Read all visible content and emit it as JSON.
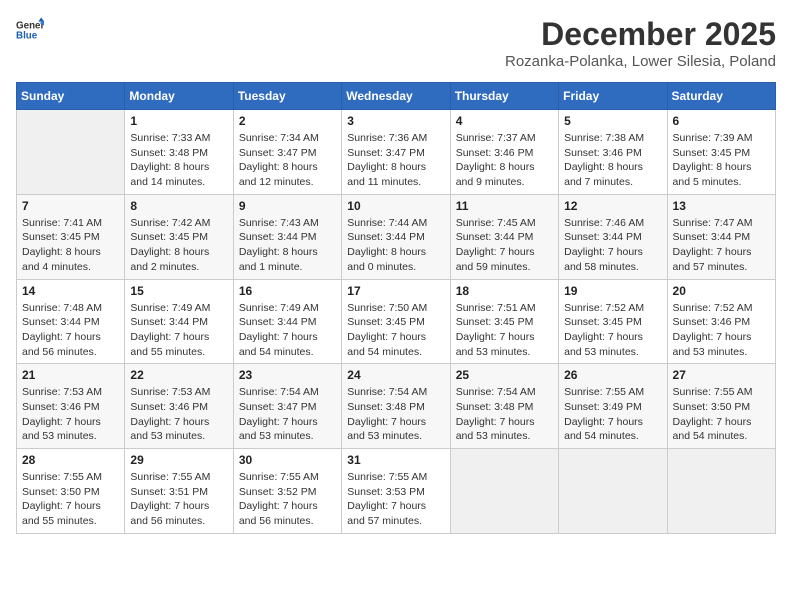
{
  "logo": {
    "general": "General",
    "blue": "Blue"
  },
  "title": "December 2025",
  "location": "Rozanka-Polanka, Lower Silesia, Poland",
  "days_of_week": [
    "Sunday",
    "Monday",
    "Tuesday",
    "Wednesday",
    "Thursday",
    "Friday",
    "Saturday"
  ],
  "weeks": [
    [
      {
        "day": "",
        "info": ""
      },
      {
        "day": "1",
        "info": "Sunrise: 7:33 AM\nSunset: 3:48 PM\nDaylight: 8 hours\nand 14 minutes."
      },
      {
        "day": "2",
        "info": "Sunrise: 7:34 AM\nSunset: 3:47 PM\nDaylight: 8 hours\nand 12 minutes."
      },
      {
        "day": "3",
        "info": "Sunrise: 7:36 AM\nSunset: 3:47 PM\nDaylight: 8 hours\nand 11 minutes."
      },
      {
        "day": "4",
        "info": "Sunrise: 7:37 AM\nSunset: 3:46 PM\nDaylight: 8 hours\nand 9 minutes."
      },
      {
        "day": "5",
        "info": "Sunrise: 7:38 AM\nSunset: 3:46 PM\nDaylight: 8 hours\nand 7 minutes."
      },
      {
        "day": "6",
        "info": "Sunrise: 7:39 AM\nSunset: 3:45 PM\nDaylight: 8 hours\nand 5 minutes."
      }
    ],
    [
      {
        "day": "7",
        "info": "Sunrise: 7:41 AM\nSunset: 3:45 PM\nDaylight: 8 hours\nand 4 minutes."
      },
      {
        "day": "8",
        "info": "Sunrise: 7:42 AM\nSunset: 3:45 PM\nDaylight: 8 hours\nand 2 minutes."
      },
      {
        "day": "9",
        "info": "Sunrise: 7:43 AM\nSunset: 3:44 PM\nDaylight: 8 hours\nand 1 minute."
      },
      {
        "day": "10",
        "info": "Sunrise: 7:44 AM\nSunset: 3:44 PM\nDaylight: 8 hours\nand 0 minutes."
      },
      {
        "day": "11",
        "info": "Sunrise: 7:45 AM\nSunset: 3:44 PM\nDaylight: 7 hours\nand 59 minutes."
      },
      {
        "day": "12",
        "info": "Sunrise: 7:46 AM\nSunset: 3:44 PM\nDaylight: 7 hours\nand 58 minutes."
      },
      {
        "day": "13",
        "info": "Sunrise: 7:47 AM\nSunset: 3:44 PM\nDaylight: 7 hours\nand 57 minutes."
      }
    ],
    [
      {
        "day": "14",
        "info": "Sunrise: 7:48 AM\nSunset: 3:44 PM\nDaylight: 7 hours\nand 56 minutes."
      },
      {
        "day": "15",
        "info": "Sunrise: 7:49 AM\nSunset: 3:44 PM\nDaylight: 7 hours\nand 55 minutes."
      },
      {
        "day": "16",
        "info": "Sunrise: 7:49 AM\nSunset: 3:44 PM\nDaylight: 7 hours\nand 54 minutes."
      },
      {
        "day": "17",
        "info": "Sunrise: 7:50 AM\nSunset: 3:45 PM\nDaylight: 7 hours\nand 54 minutes."
      },
      {
        "day": "18",
        "info": "Sunrise: 7:51 AM\nSunset: 3:45 PM\nDaylight: 7 hours\nand 53 minutes."
      },
      {
        "day": "19",
        "info": "Sunrise: 7:52 AM\nSunset: 3:45 PM\nDaylight: 7 hours\nand 53 minutes."
      },
      {
        "day": "20",
        "info": "Sunrise: 7:52 AM\nSunset: 3:46 PM\nDaylight: 7 hours\nand 53 minutes."
      }
    ],
    [
      {
        "day": "21",
        "info": "Sunrise: 7:53 AM\nSunset: 3:46 PM\nDaylight: 7 hours\nand 53 minutes."
      },
      {
        "day": "22",
        "info": "Sunrise: 7:53 AM\nSunset: 3:46 PM\nDaylight: 7 hours\nand 53 minutes."
      },
      {
        "day": "23",
        "info": "Sunrise: 7:54 AM\nSunset: 3:47 PM\nDaylight: 7 hours\nand 53 minutes."
      },
      {
        "day": "24",
        "info": "Sunrise: 7:54 AM\nSunset: 3:48 PM\nDaylight: 7 hours\nand 53 minutes."
      },
      {
        "day": "25",
        "info": "Sunrise: 7:54 AM\nSunset: 3:48 PM\nDaylight: 7 hours\nand 53 minutes."
      },
      {
        "day": "26",
        "info": "Sunrise: 7:55 AM\nSunset: 3:49 PM\nDaylight: 7 hours\nand 54 minutes."
      },
      {
        "day": "27",
        "info": "Sunrise: 7:55 AM\nSunset: 3:50 PM\nDaylight: 7 hours\nand 54 minutes."
      }
    ],
    [
      {
        "day": "28",
        "info": "Sunrise: 7:55 AM\nSunset: 3:50 PM\nDaylight: 7 hours\nand 55 minutes."
      },
      {
        "day": "29",
        "info": "Sunrise: 7:55 AM\nSunset: 3:51 PM\nDaylight: 7 hours\nand 56 minutes."
      },
      {
        "day": "30",
        "info": "Sunrise: 7:55 AM\nSunset: 3:52 PM\nDaylight: 7 hours\nand 56 minutes."
      },
      {
        "day": "31",
        "info": "Sunrise: 7:55 AM\nSunset: 3:53 PM\nDaylight: 7 hours\nand 57 minutes."
      },
      {
        "day": "",
        "info": ""
      },
      {
        "day": "",
        "info": ""
      },
      {
        "day": "",
        "info": ""
      }
    ]
  ]
}
